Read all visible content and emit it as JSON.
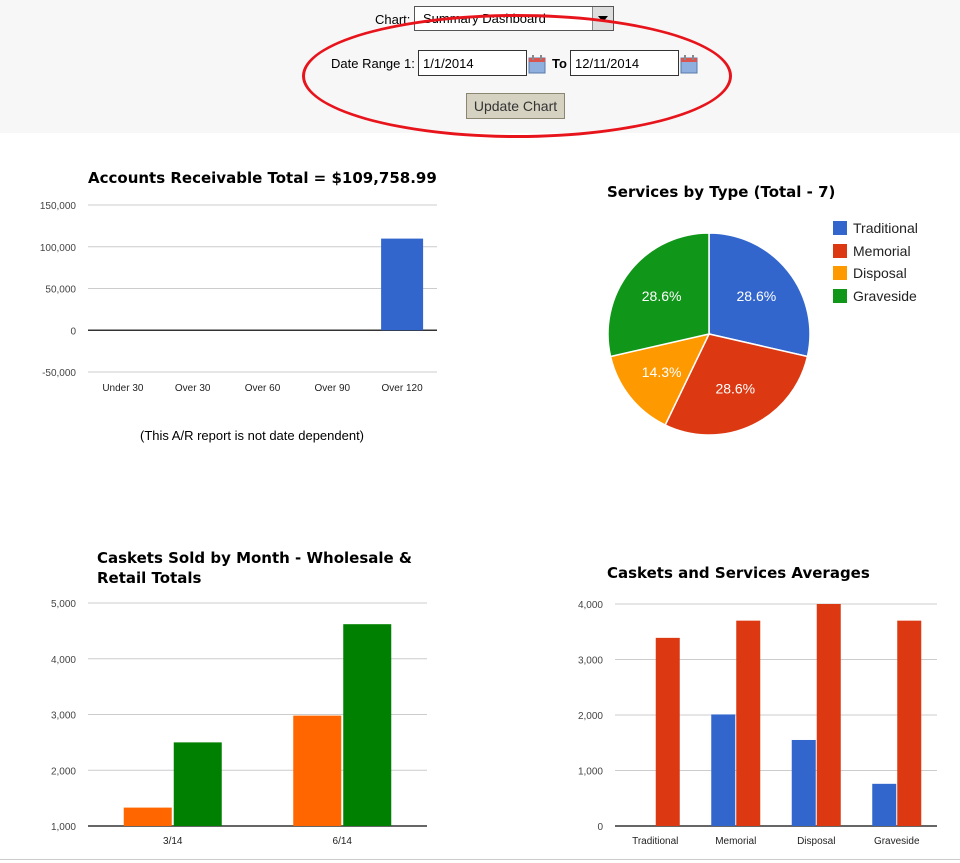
{
  "controls": {
    "chart_label": "Chart:",
    "chart_value": "Summary Dashboard",
    "date_range_label": "Date Range 1:",
    "date_from": "1/1/2014",
    "to_label": "To",
    "date_to": "12/11/2014",
    "update_button": "Update Chart",
    "annotation_color": "#e8141c"
  },
  "ar_note": "(This A/R report is not date dependent)",
  "chart_data": [
    {
      "type": "bar",
      "title": "Accounts Receivable Total = $109,758.99",
      "categories": [
        "Under 30",
        "Over 30",
        "Over 60",
        "Over 90",
        "Over 120"
      ],
      "values": [
        0,
        0,
        0,
        0,
        109758.99
      ],
      "ylim": [
        -50000,
        150000
      ],
      "yticks": [
        150000,
        100000,
        50000,
        0,
        -50000
      ],
      "ytick_labels": [
        "150,000",
        "100,000",
        "50,000",
        "0",
        "-50,000"
      ],
      "colors": [
        "#3366cc"
      ],
      "grid": true
    },
    {
      "type": "pie",
      "title": "Services by Type (Total - 7)",
      "labels": [
        "Traditional",
        "Memorial",
        "Disposal",
        "Graveside"
      ],
      "values": [
        2,
        2,
        1,
        2
      ],
      "slice_labels": [
        "28.6%",
        "28.6%",
        "14.3%",
        "28.6%"
      ],
      "colors": [
        "#3366cc",
        "#dc3912",
        "#ff9900",
        "#109618"
      ],
      "legend": "right"
    },
    {
      "type": "bar",
      "title": "Caskets Sold by Month - Wholesale & Retail Totals",
      "categories": [
        "3/14",
        "6/14"
      ],
      "series": [
        {
          "values": [
            1330,
            2980
          ],
          "color": "#ff6600"
        },
        {
          "values": [
            2500,
            4620
          ],
          "color": "#008000"
        }
      ],
      "ylim": [
        1000,
        5000
      ],
      "yticks": [
        5000,
        4000,
        3000,
        2000,
        1000
      ],
      "ytick_labels": [
        "5,000",
        "4,000",
        "3,000",
        "2,000",
        "1,000"
      ],
      "grid": true
    },
    {
      "type": "bar",
      "title": "Caskets and Services Averages",
      "categories": [
        "Traditional",
        "Memorial",
        "Disposal",
        "Graveside"
      ],
      "series": [
        {
          "values": [
            0,
            2010,
            1550,
            760
          ],
          "color": "#3366cc"
        },
        {
          "values": [
            3390,
            3700,
            4000,
            3700
          ],
          "color": "#dc3912"
        }
      ],
      "ylim": [
        0,
        4000
      ],
      "yticks": [
        4000,
        3000,
        2000,
        1000,
        0
      ],
      "ytick_labels": [
        "4,000",
        "3,000",
        "2,000",
        "1,000",
        "0"
      ],
      "grid": true
    }
  ]
}
